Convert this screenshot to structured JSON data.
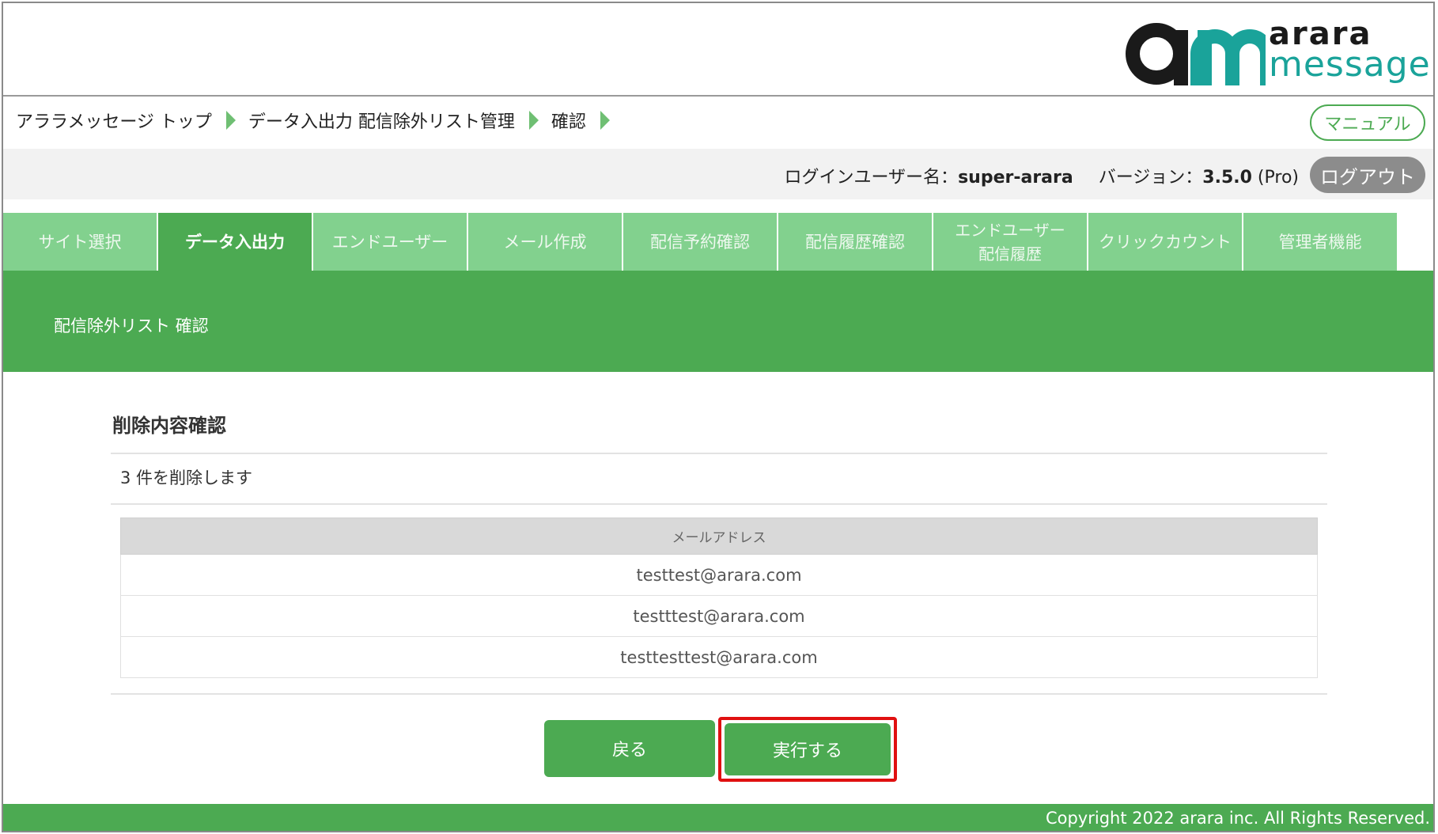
{
  "logo": {
    "line1": "arara",
    "line2": "message",
    "brand_color": "#1aa39a"
  },
  "breadcrumb": [
    "アララメッセージ トップ",
    "データ入出力 配信除外リスト管理",
    "確認"
  ],
  "header": {
    "manual_label": "マニュアル"
  },
  "login": {
    "user_label": "ログインユーザー名：",
    "user_name": "super-arara",
    "version_label": "バージョン：",
    "version": "3.5.0",
    "edition": "(Pro)",
    "logout_label": "ログアウト"
  },
  "tabs": [
    {
      "label": "サイト選択",
      "active": false
    },
    {
      "label": "データ入出力",
      "active": true
    },
    {
      "label": "エンドユーザー",
      "active": false
    },
    {
      "label": "メール作成",
      "active": false
    },
    {
      "label": "配信予約確認",
      "active": false
    },
    {
      "label": "配信履歴確認",
      "active": false
    },
    {
      "label": "エンドユーザー\n配信履歴",
      "active": false
    },
    {
      "label": "クリックカウント",
      "active": false
    },
    {
      "label": "管理者機能",
      "active": false
    }
  ],
  "section": {
    "title": "配信除外リスト 確認"
  },
  "content": {
    "title": "削除内容確認",
    "count_text": "3 件を削除します",
    "table_header": "メールアドレス",
    "emails": [
      "testtest@arara.com",
      "testttest@arara.com",
      "testtesttest@arara.com"
    ]
  },
  "actions": {
    "back_label": "戻る",
    "execute_label": "実行する"
  },
  "footer": {
    "copyright": "Copyright 2022 arara inc. All Rights Reserved."
  },
  "colors": {
    "accent": "#4caa52",
    "tab_inactive": "#82d18e",
    "highlight": "#e01010",
    "logout_bg": "#8c8c8c"
  }
}
